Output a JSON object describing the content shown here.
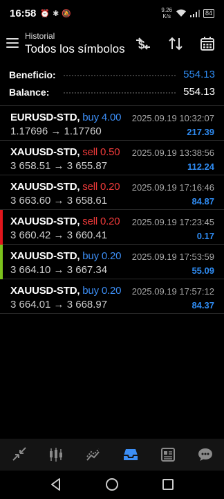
{
  "status_bar": {
    "time": "16:58",
    "net_speed_value": "9.26",
    "net_speed_unit": "K/s",
    "battery": "84"
  },
  "header": {
    "subtitle": "Historial",
    "title": "Todos los símbolos"
  },
  "summary": {
    "profit_label": "Beneficio:",
    "profit_value": "554.13",
    "balance_label": "Balance:",
    "balance_value": "554.13"
  },
  "trades": [
    {
      "symbol": "EURUSD-STD,",
      "side": "buy",
      "volume": "4.00",
      "prices": "1.17696 → 1.17760",
      "time": "2025.09.19 10:32:07",
      "profit": "217.39",
      "marker": ""
    },
    {
      "symbol": "XAUUSD-STD,",
      "side": "sell",
      "volume": "0.50",
      "prices": "3 658.51 → 3 655.87",
      "time": "2025.09.19 13:38:56",
      "profit": "112.24",
      "marker": ""
    },
    {
      "symbol": "XAUUSD-STD,",
      "side": "sell",
      "volume": "0.20",
      "prices": "3 663.60 → 3 658.61",
      "time": "2025.09.19 17:16:46",
      "profit": "84.87",
      "marker": ""
    },
    {
      "symbol": "XAUUSD-STD,",
      "side": "sell",
      "volume": "0.20",
      "prices": "3 660.42 → 3 660.41",
      "time": "2025.09.19 17:23:45",
      "profit": "0.17",
      "marker": "#e0161c"
    },
    {
      "symbol": "XAUUSD-STD,",
      "side": "buy",
      "volume": "0.20",
      "prices": "3 664.10 → 3 667.34",
      "time": "2025.09.19 17:53:59",
      "profit": "55.09",
      "marker": "#7cc21c"
    },
    {
      "symbol": "XAUUSD-STD,",
      "side": "buy",
      "volume": "0.20",
      "prices": "3 664.01 → 3 668.97",
      "time": "2025.09.19 17:57:12",
      "profit": "84.37",
      "marker": ""
    }
  ],
  "bottom_nav": [
    "quotes-icon",
    "chart-icon",
    "trade-icon",
    "history-icon",
    "news-icon",
    "chat-icon"
  ],
  "colors": {
    "accent_blue": "#2f8cf3",
    "sell_red": "#f03a3a",
    "active_nav": "#3c8ef5"
  }
}
